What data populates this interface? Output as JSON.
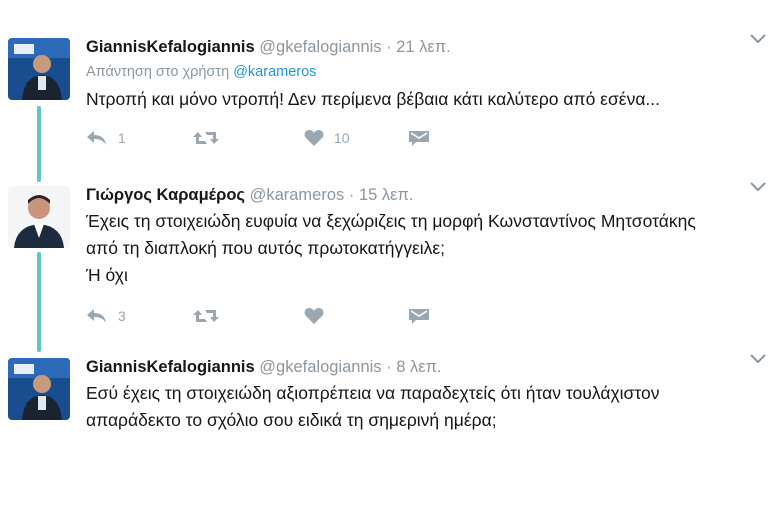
{
  "tweets": [
    {
      "name": "GiannisKefalogiannis",
      "handle": "@gkefalogiannis",
      "dot": "·",
      "time": "21 λεπ.",
      "reply_prefix": "Απάντηση στο χρήστη",
      "reply_mention": "@karameros",
      "lines": [
        "Ντροπή και μόνο ντροπή! Δεν περίμενα βέβαια κάτι καλύτερο από εσένα..."
      ],
      "reply_count": "1",
      "retweet_count": "",
      "like_count": "10"
    },
    {
      "name": "Γιώργος Καραμέρος",
      "handle": "@karameros",
      "dot": "·",
      "time": "15 λεπ.",
      "lines": [
        "Έχεις τη στοιχειώδη ευφυία να ξεχώριζεις τη μορφή Κωνσταντίνος Μητσοτάκης",
        "από τη διαπλοκή που αυτός πρωτοκατήγγειλε;",
        "Ή όχι"
      ],
      "reply_count": "3",
      "retweet_count": "",
      "like_count": ""
    },
    {
      "name": "GiannisKefalogiannis",
      "handle": "@gkefalogiannis",
      "dot": "·",
      "time": "8 λεπ.",
      "lines": [
        "Εσύ έχεις τη στοιχειώδη αξιοπρέπεια να παραδεχτείς ότι ήταν τουλάχιστον",
        "απαράδεκτο το σχόλιο σου ειδικά τη σημερινή ημέρα;"
      ]
    }
  ],
  "colors": {
    "thread_line": "#5cc7c3",
    "mention": "#1b95e0",
    "secondary_text": "#8a96a0",
    "action_icon": "#9aa6b0",
    "avatar_blue": "#1a4d8f"
  },
  "icons": [
    "reply-icon",
    "retweet-icon",
    "heart-icon",
    "direct-message-icon",
    "chevron-down-icon"
  ]
}
